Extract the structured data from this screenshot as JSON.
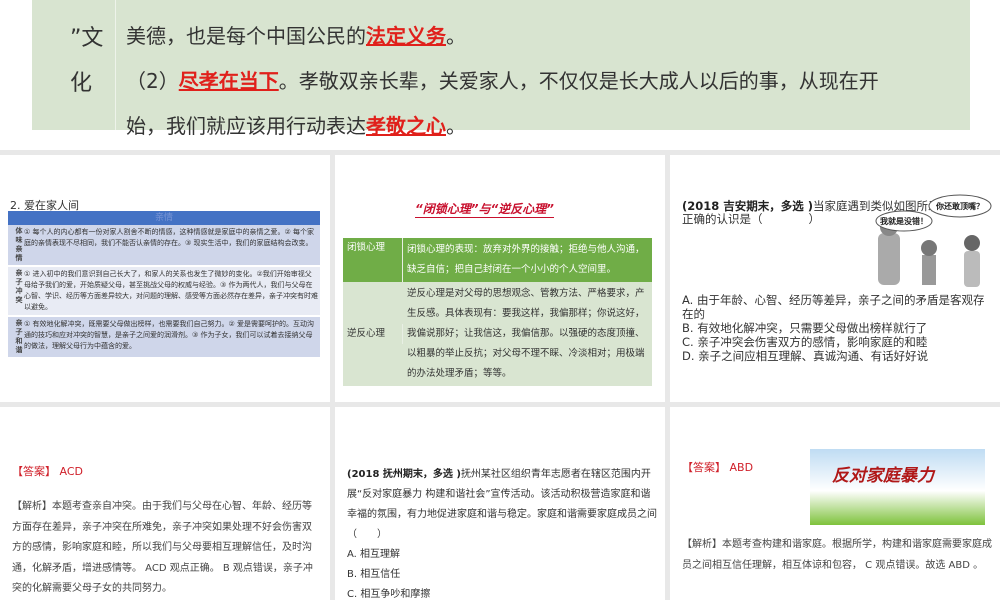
{
  "slide1": {
    "left_col": [
      "”文",
      "化"
    ],
    "line1_a": "美德，也是每个中国公民的",
    "line1_red": "法定义务",
    "line1_b": "。",
    "line2_a": "（2）",
    "line2_red": "尽孝在当下",
    "line2_b": "。孝敬双亲长辈，关爱家人，不仅仅是长大成人以后的事，从现在开",
    "line3_a": "始，我们就应该用行动表达",
    "line3_red": "孝敬之心",
    "line3_b": "。"
  },
  "slide2": {
    "title": "2. 爱在家人间",
    "table_header": "亲情",
    "rows": [
      {
        "key": "体味亲情",
        "text": "① 每个人的内心都有一份对家人割舍不断的情感，这种情感就是家庭中的亲情之爱。② 每个家庭的亲情表现不尽相同，我们不能否认亲情的存在。③ 现实生活中，我们的家庭结构会改变。"
      },
      {
        "key": "亲子冲突",
        "text": "① 进入初中的我们意识到自己长大了，和家人的关系也发生了微妙的变化。②我们开始审视父母给予我们的爱，开始质疑父母，甚至挑战父母的权威与经验。③ 作为两代人，我们与父母在心智、学识、经历等方面差异较大，对问题的理解、感受等方面必然存在差异，亲子冲突有时难以避免。"
      },
      {
        "key": "亲子和谐",
        "text": "① 有效地化解冲突，既需要父母做出榜样，也需要我们自己努力。② 爱是需要呵护的。互动沟通的技巧和应对冲突的智慧，是亲子之间爱的润滑剂。③ 作为子女，我们可以试着去接纳父母的做法，理解父母行为中蕴含的爱。"
      }
    ]
  },
  "slide3": {
    "title": "“闭锁心理”与“逆反心理”",
    "rows": [
      {
        "name": "闭锁心理",
        "desc": "闭锁心理的表现：放弃对外界的接触；拒绝与他人沟通，缺乏自信；把自己封闭在一个小小的个人空间里。"
      },
      {
        "name": "逆反心理",
        "desc": "逆反心理是对父母的思想观念、管教方法、严格要求，产生反感。具体表现有：要我这样，我偏那样；你说这好，我偏说那好；让我信这，我偏信那。以强硬的态度顶撞、以粗暴的举止反抗；对父母不理不睬、冷淡相对；用极端的办法处理矛盾；等等。"
      }
    ]
  },
  "slide4": {
    "source": "(2018 吉安期末，多选 )",
    "stem": "当家庭遇到类似如图所示情况时，正确的认识是（　　　　）",
    "bubble1": "我就是没错！",
    "bubble2": "你还敢顶嘴？",
    "options": [
      "A. 由于年龄、心智、经历等差异，亲子之间的矛盾是客观存在的",
      "B. 有效地化解冲突，只需要父母做出榜样就行了",
      "C. 亲子冲突会伤害双方的感情，影响家庭的和睦",
      "D. 亲子之间应相互理解、真诚沟通、有话好好说"
    ]
  },
  "slide5": {
    "answer": "【答案】 ACD",
    "analysis": "【解析】本题考查亲自冲突。由于我们与父母在心智、年龄、经历等方面存在差异，亲子冲突在所难免，亲子冲突如果处理不好会伤害双方的感情，影响家庭和睦，所以我们与父母要相互理解信任，及时沟通，化解矛盾，增进感情等。 ACD 观点正确。 B 观点错误，亲子冲突的化解需要父母子女的共同努力。"
  },
  "slide6": {
    "source": "(2018 抚州期末，多选 )",
    "stem": "抚州某社区组织青年志愿者在辖区范围内开展“反对家庭暴力 构建和谐社会”宣传活动。该活动积极营造家庭和谐幸福的氛围，有力地促进家庭和谐与稳定。家庭和谐需要家庭成员之间（　　）",
    "options": [
      "A. 相互理解",
      "B. 相互信任",
      "C. 相互争吵和摩擦"
    ]
  },
  "slide7": {
    "answer": "【答案】 ABD",
    "banner": "反对家庭暴力",
    "analysis": "【解析】本题考查构建和谐家庭。根据所学，构建和谐家庭需要家庭成员之间相互信任理解，相互体谅和包容， C 观点错误。故选 ABD 。"
  }
}
